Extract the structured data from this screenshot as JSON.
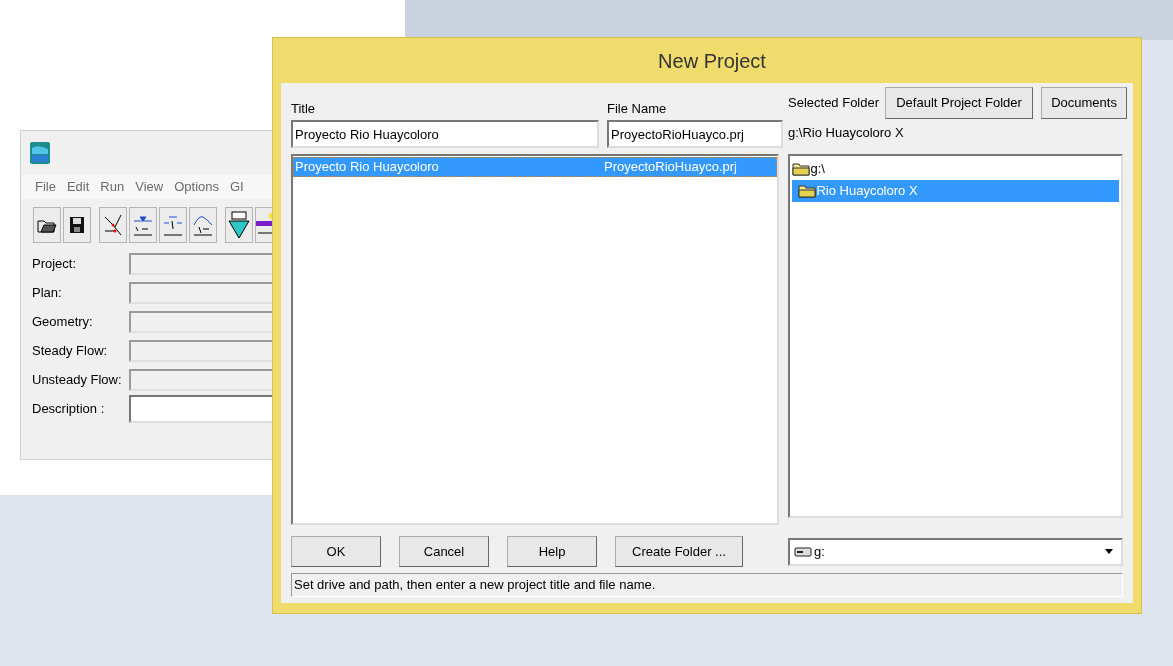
{
  "main_window": {
    "menu": [
      "File",
      "Edit",
      "Run",
      "View",
      "Options",
      "GI"
    ],
    "fields": [
      {
        "label": "Project:",
        "kind": "readonly"
      },
      {
        "label": "Plan:",
        "kind": "readonly"
      },
      {
        "label": "Geometry:",
        "kind": "readonly"
      },
      {
        "label": "Steady Flow:",
        "kind": "readonly"
      },
      {
        "label": "Unsteady Flow:",
        "kind": "readonly"
      },
      {
        "label": "Description :",
        "kind": "editable"
      }
    ]
  },
  "dialog": {
    "title": "New Project",
    "title_label": "Title",
    "title_value": "Proyecto Rio Huaycoloro",
    "file_label": "File Name",
    "file_value": "ProyectoRioHuayco.prj",
    "folder_label": "Selected Folder",
    "folder_buttons": [
      "Default Project Folder",
      "Documents"
    ],
    "folder_path": "g:\\Rio Huaycoloro X",
    "projects": [
      {
        "title": "Proyecto Rio Huaycoloro",
        "file": "ProyectoRioHuayco.prj",
        "selected": true
      }
    ],
    "folders": [
      {
        "name": "g:\\",
        "selected": false,
        "children": [
          {
            "name": "Rio Huaycoloro X",
            "selected": true
          }
        ]
      }
    ],
    "buttons": [
      "OK",
      "Cancel",
      "Help",
      "Create Folder ..."
    ],
    "drive": "g:",
    "status_bar": "Set drive and path, then enter a new project title and file name."
  }
}
